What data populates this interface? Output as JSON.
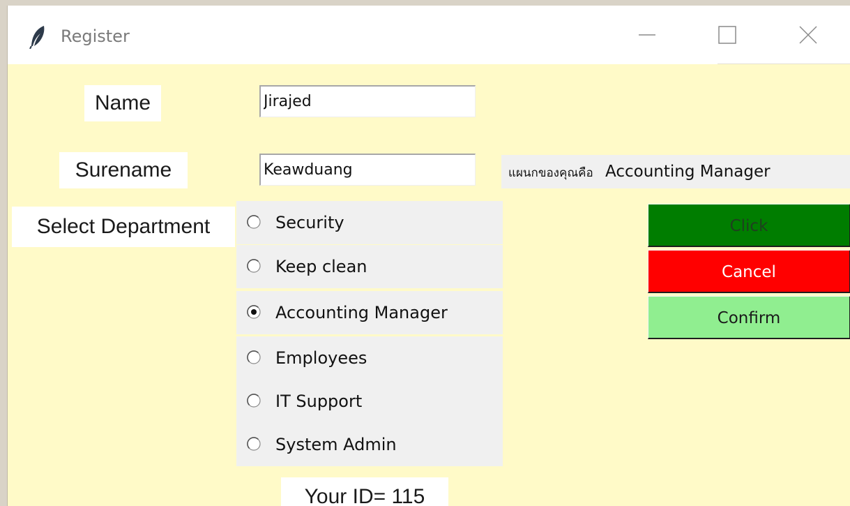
{
  "window": {
    "title": "Register",
    "bg_color": "#fffac8",
    "title_icon": "feather-icon"
  },
  "form": {
    "name_label": "Name",
    "name_value": "Jirajed",
    "surename_label": "Surename",
    "surename_value": "Keawduang",
    "department_label": "Select Department",
    "department_display_prefix": "แผนกของคุณคือ",
    "department_display_value": "Accounting Manager",
    "id_text": "Your ID= 115"
  },
  "departments": [
    {
      "label": "Security",
      "selected": false
    },
    {
      "label": "Keep clean",
      "selected": false
    },
    {
      "label": "Accounting Manager",
      "selected": true
    },
    {
      "label": "Employees",
      "selected": false
    },
    {
      "label": "IT Support",
      "selected": false
    },
    {
      "label": "System Admin",
      "selected": false
    }
  ],
  "buttons": {
    "click": {
      "label": "Click",
      "bg": "#007d00",
      "fg": "#1f3f1f"
    },
    "cancel": {
      "label": "Cancel",
      "bg": "#ff0000",
      "fg": "#ffffff"
    },
    "confirm": {
      "label": "Confirm",
      "bg": "#90ee90",
      "fg": "#1a1a1a"
    }
  }
}
